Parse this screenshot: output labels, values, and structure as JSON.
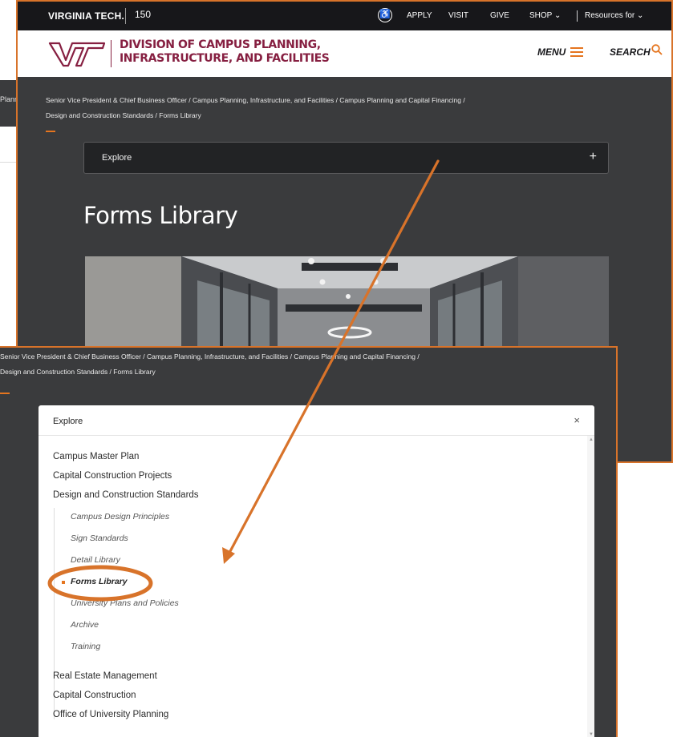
{
  "top_window": {
    "topbar": {
      "brand": "VIRGINIA TECH.",
      "anniversary_mark": "150",
      "links": [
        "APPLY",
        "VISIT",
        "GIVE",
        "SHOP",
        "Resources for"
      ]
    },
    "header": {
      "division_line1": "DIVISION OF CAMPUS PLANNING,",
      "division_line2": "INFRASTRUCTURE, AND FACILITIES",
      "menu_label": "MENU",
      "search_label": "SEARCH"
    },
    "breadcrumb": {
      "line1": "Senior Vice President & Chief Business Officer  /  Campus Planning, Infrastructure, and Facilities  /  Campus Planning and Capital Financing  /",
      "line2": "Design and Construction Standards  /  Forms Library"
    },
    "explore": {
      "label": "Explore",
      "toggle": "+"
    },
    "page_title": "Forms Library"
  },
  "background_window": {
    "fragment": "Planni"
  },
  "bottom_window": {
    "breadcrumb": {
      "line1": "Senior Vice President & Chief Business Officer  /  Campus Planning, Infrastructure, and Facilities  /  Campus Planning and Capital Financing  /",
      "line2": "Design and Construction Standards  /  Forms Library"
    },
    "explore_panel": {
      "label": "Explore",
      "close": "×",
      "main_items": [
        "Campus Master Plan",
        "Capital Construction Projects",
        "Design and Construction Standards"
      ],
      "sub_items": [
        "Campus Design Principles",
        "Sign Standards",
        "Detail Library",
        "Forms Library",
        "University Plans and Policies",
        "Archive",
        "Training"
      ],
      "current_sub_item": "Forms Library",
      "trailing_items": [
        "Real Estate Management",
        "Capital Construction",
        "Office of University Planning"
      ]
    }
  },
  "colors": {
    "accent_orange": "#e5751f",
    "annotation_orange": "#d8732a",
    "maroon": "#861f41",
    "dark_bg": "#3a3b3d",
    "topbar_bg": "#17171a"
  }
}
